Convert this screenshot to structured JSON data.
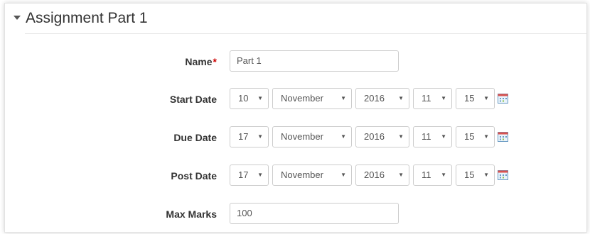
{
  "section": {
    "title": "Assignment Part 1"
  },
  "name": {
    "label": "Name",
    "required_marker": "*",
    "value": "Part 1"
  },
  "dates": [
    {
      "label": "Start Date",
      "day": "10",
      "month": "November",
      "year": "2016",
      "hour": "11",
      "minute": "15"
    },
    {
      "label": "Due Date",
      "day": "17",
      "month": "November",
      "year": "2016",
      "hour": "11",
      "minute": "15"
    },
    {
      "label": "Post Date",
      "day": "17",
      "month": "November",
      "year": "2016",
      "hour": "11",
      "minute": "15"
    }
  ],
  "max_marks": {
    "label": "Max Marks",
    "value": "100"
  },
  "icons": {
    "collapse": "caret-down-icon",
    "calendar": "calendar-icon",
    "dropdown": "dropdown-caret-icon"
  },
  "colors": {
    "required": "#cc0000",
    "border": "#cccccc",
    "label": "#333333"
  }
}
